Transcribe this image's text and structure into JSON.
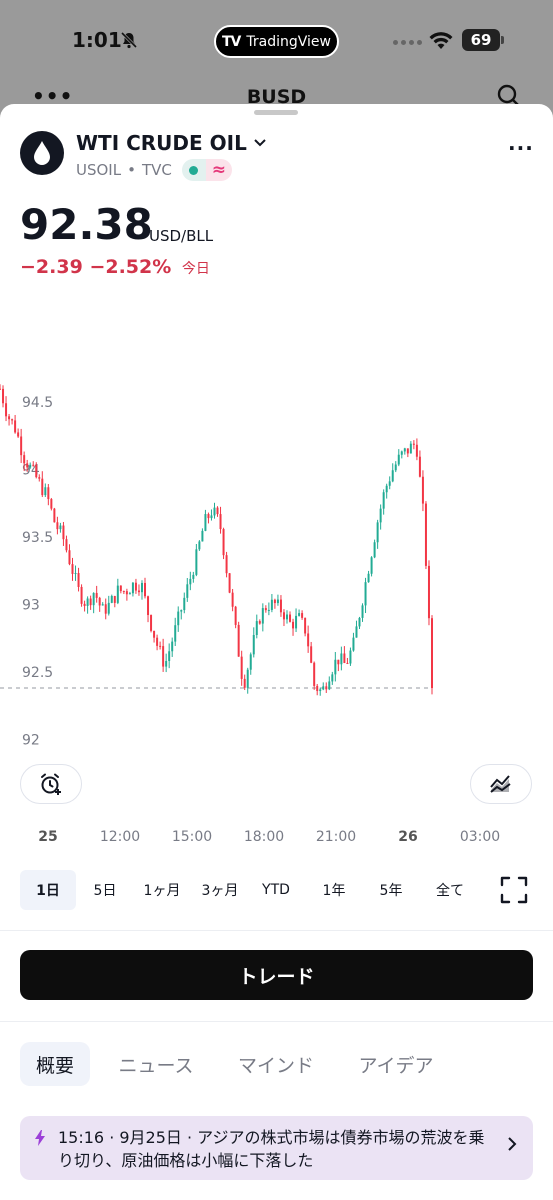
{
  "status_bar": {
    "time": "1:01",
    "app_pill": "TradingView",
    "battery": "69"
  },
  "behind_header": {
    "title": "BUSD",
    "more": "•••"
  },
  "symbol": {
    "name": "WTI CRUDE OIL",
    "ticker": "USOIL",
    "separator": "•",
    "exchange": "TVC"
  },
  "quote": {
    "price": "92.38",
    "unit": "USD/BLL",
    "change": "−2.39",
    "change_pct": "−2.52%",
    "period": "今日"
  },
  "chart_data": {
    "type": "candlestick",
    "y_ticks": [
      "94.5",
      "94",
      "93.5",
      "93",
      "92.5",
      "92"
    ],
    "ylim": [
      91.95,
      94.65
    ],
    "x_ticks": [
      "25",
      "12:00",
      "15:00",
      "18:00",
      "21:00",
      "26",
      "03:00"
    ],
    "last_price_line": 92.38,
    "close_path": [
      94.6,
      94.4,
      94.3,
      94.1,
      94.0,
      93.9,
      93.8,
      93.6,
      93.5,
      93.3,
      93.1,
      93.0,
      93.1,
      92.95,
      93.0,
      93.1,
      93.1,
      93.15,
      93.15,
      92.9,
      92.7,
      92.55,
      92.75,
      92.95,
      93.15,
      93.35,
      93.6,
      93.7,
      93.6,
      93.2,
      92.8,
      92.4,
      92.65,
      92.9,
      93.0,
      93.0,
      92.95,
      92.85,
      92.9,
      92.8,
      92.4,
      92.35,
      92.5,
      92.6,
      92.55,
      92.7,
      93.0,
      93.3,
      93.6,
      93.85,
      94.0,
      94.1,
      94.15,
      94.2,
      93.6,
      92.38
    ],
    "colors": {
      "up": "#22ab94",
      "down": "#f23645"
    }
  },
  "ranges": [
    "1日",
    "5日",
    "1ヶ月",
    "3ヶ月",
    "YTD",
    "1年",
    "5年",
    "全て"
  ],
  "active_range": "1日",
  "trade_button": "トレード",
  "tabs": [
    "概要",
    "ニュース",
    "マインド",
    "アイデア"
  ],
  "news": {
    "text": "15:16 · 9月25日 · アジアの株式市場は債券市場の荒波を乗り切り、原油価格は小幅に下落した"
  },
  "icons": {
    "bell": "bell-slash-icon",
    "wifi": "wifi-icon",
    "search": "search-icon",
    "drop": "oil-drop-icon",
    "alert": "alarm-plus-icon",
    "chart_type": "area-chart-icon",
    "fullscreen": "fullscreen-icon",
    "bolt": "lightning-icon"
  }
}
